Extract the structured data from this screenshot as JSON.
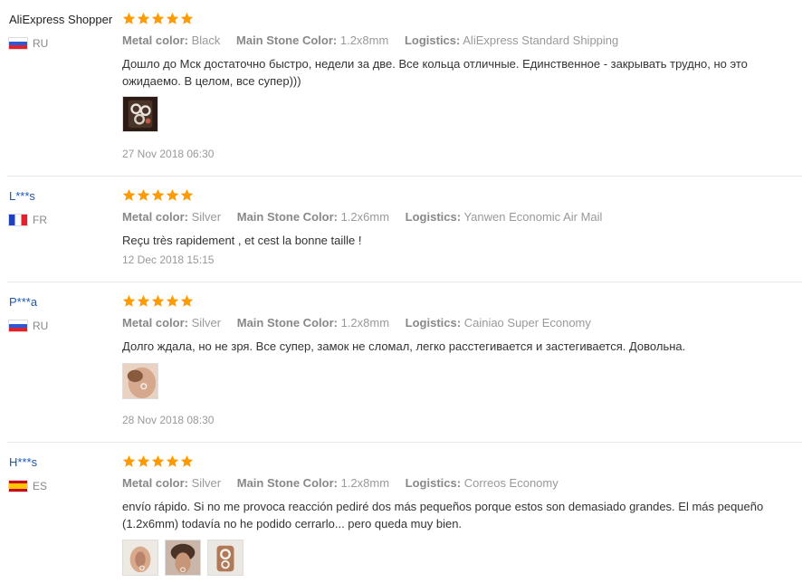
{
  "labels": {
    "metal_color": "Metal color:",
    "main_stone_color": "Main Stone Color:",
    "logistics": "Logistics:"
  },
  "star_color": "#ff9a00",
  "reviews": [
    {
      "user": "AliExpress Shopper",
      "country": "RU",
      "stars": 5,
      "metal_color": "Black",
      "main_stone_color": "1.2x8mm",
      "logistics": "AliExpress Standard Shipping",
      "text": "Дошло до Мск достаточно быстро, недели за две. Все кольца отличные. Единственное - закрывать трудно, но это ожидаемо. В целом, все супер)))",
      "photos": [
        "ring-photo"
      ],
      "date": "27 Nov 2018 06:30"
    },
    {
      "user": "L***s",
      "country": "FR",
      "stars": 5,
      "metal_color": "Silver",
      "main_stone_color": "1.2x6mm",
      "logistics": "Yanwen Economic Air Mail",
      "text": "Reçu très rapidement , et cest la bonne taille !",
      "photos": [],
      "date": "12 Dec 2018 15:15"
    },
    {
      "user": "P***a",
      "country": "RU",
      "stars": 5,
      "metal_color": "Silver",
      "main_stone_color": "1.2x8mm",
      "logistics": "Cainiao Super Economy",
      "text": "Долго ждала, но не зря. Все супер, замок не сломал, легко расстегивается и застегивается. Довольна.",
      "photos": [
        "ear-photo"
      ],
      "date": "28 Nov 2018 08:30"
    },
    {
      "user": "H***s",
      "country": "ES",
      "stars": 5,
      "metal_color": "Silver",
      "main_stone_color": "1.2x8mm",
      "logistics": "Correos Economy",
      "text": "envío rápido. Si no me provoca reacción pediré dos más pequeños porque estos son demasiado grandes. El más pequeño (1.2x6mm) todavía no he podido cerrarlo... pero queda muy bien.",
      "photos": [
        "ear-photo",
        "ear-photo",
        "ring-photo"
      ],
      "date": ""
    }
  ]
}
